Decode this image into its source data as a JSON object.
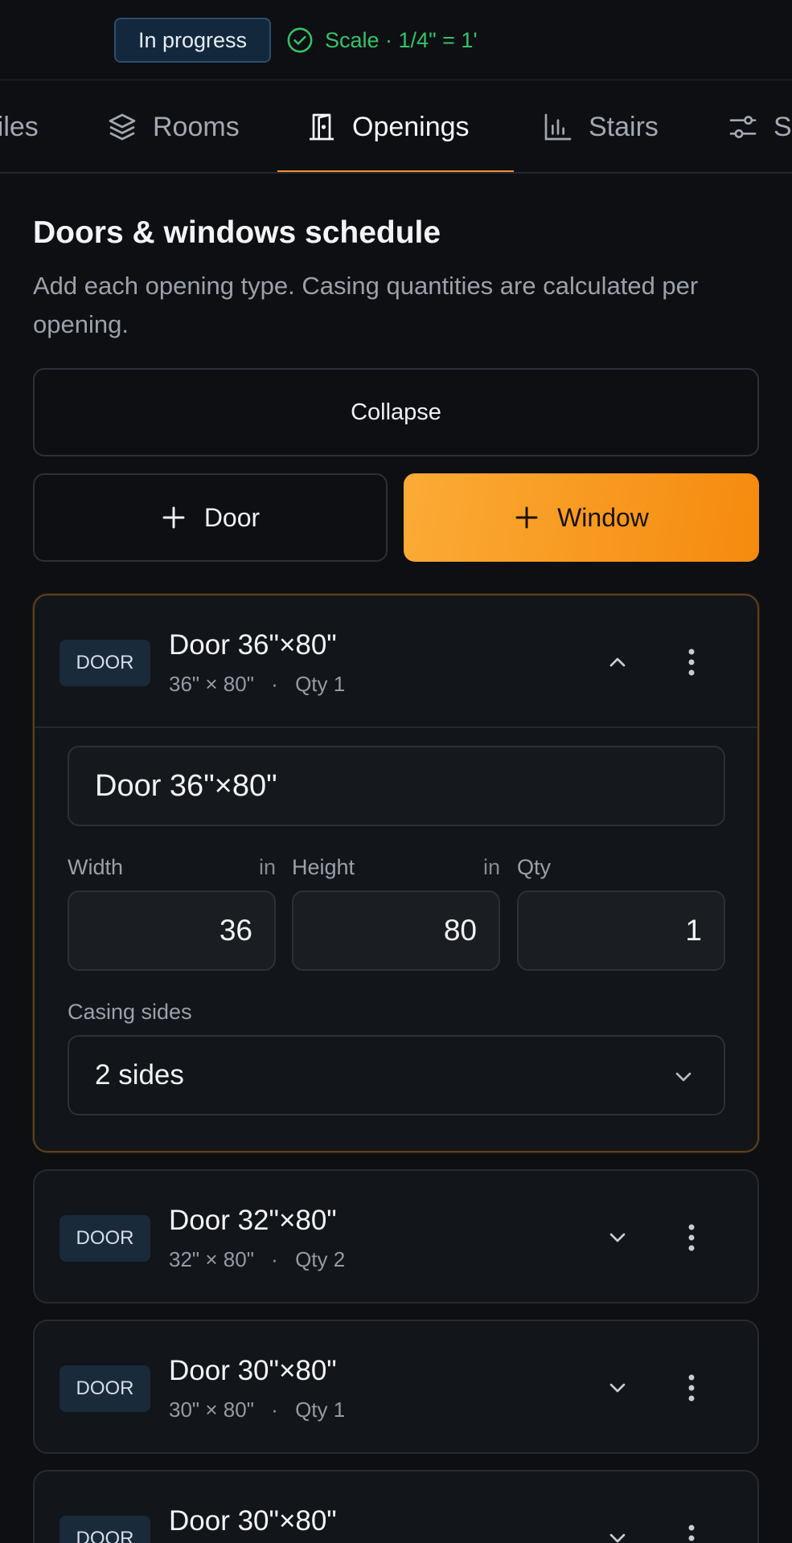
{
  "status": {
    "badge": "In progress",
    "scale": "Scale · 1/4\" = 1'"
  },
  "tabs": [
    {
      "label": "Files",
      "icon": "files-icon"
    },
    {
      "label": "Rooms",
      "icon": "layers-icon"
    },
    {
      "label": "Openings",
      "icon": "door-icon",
      "active": true
    },
    {
      "label": "Stairs",
      "icon": "bar-chart-icon"
    },
    {
      "label": "Settings",
      "icon": "sliders-icon"
    }
  ],
  "section": {
    "title": "Doors & windows schedule",
    "description": "Add each opening type. Casing quantities are calculated per opening."
  },
  "actions": {
    "collapse": "Collapse",
    "add_door": "Door",
    "add_window": "Window"
  },
  "openings": [
    {
      "type": "DOOR",
      "title": "Door 36\"×80\"",
      "dims": "36\" × 80\"",
      "qty_label": "Qty 1",
      "expanded": true,
      "name_value": "Door 36\"×80\"",
      "width_label": "Width",
      "width_unit": "in",
      "width_value": "36",
      "height_label": "Height",
      "height_unit": "in",
      "height_value": "80",
      "qty_field_label": "Qty",
      "qty_value": "1",
      "casing_label": "Casing sides",
      "casing_value": "2 sides"
    },
    {
      "type": "DOOR",
      "title": "Door 32\"×80\"",
      "dims": "32\" × 80\"",
      "qty_label": "Qty 2",
      "expanded": false
    },
    {
      "type": "DOOR",
      "title": "Door 30\"×80\"",
      "dims": "30\" × 80\"",
      "qty_label": "Qty 1",
      "expanded": false
    },
    {
      "type": "DOOR",
      "title": "Door 30\"×80\"",
      "dims": "",
      "qty_label": "",
      "expanded": false
    }
  ],
  "colors": {
    "accent": "#f58a0e",
    "success": "#36c26b",
    "badge_bg": "#192a3b"
  }
}
